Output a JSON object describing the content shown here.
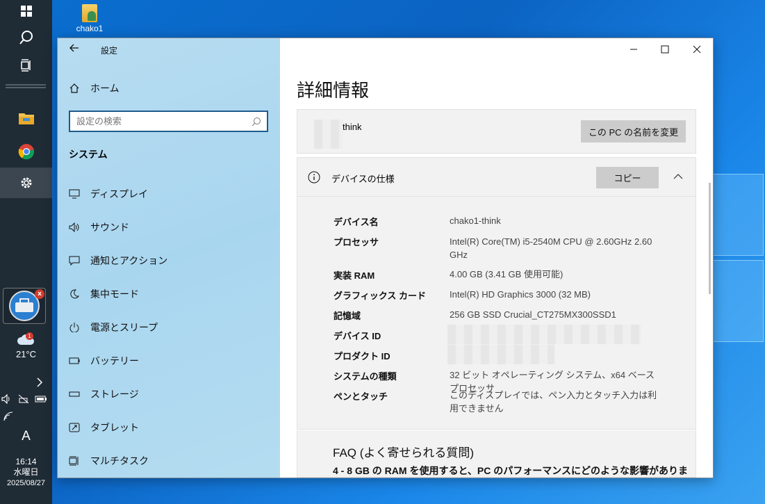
{
  "desktop": {
    "icon_label": "chako1"
  },
  "taskbar": {
    "weather_badge": "1",
    "temperature": "21°C",
    "ime": "A",
    "time": "16:14",
    "weekday": "水曜日",
    "date": "2025/08/27",
    "app_badge": "x"
  },
  "window": {
    "app_title": "設定",
    "search_placeholder": "設定の検索",
    "section_heading": "システム",
    "home_label": "ホーム",
    "nav_items": [
      {
        "label": "ディスプレイ",
        "icon": "display-icon"
      },
      {
        "label": "サウンド",
        "icon": "speaker-icon"
      },
      {
        "label": "通知とアクション",
        "icon": "notification-icon"
      },
      {
        "label": "集中モード",
        "icon": "moon-icon"
      },
      {
        "label": "電源とスリープ",
        "icon": "power-icon"
      },
      {
        "label": "バッテリー",
        "icon": "battery-icon"
      },
      {
        "label": "ストレージ",
        "icon": "storage-icon"
      },
      {
        "label": "タブレット",
        "icon": "tablet-icon"
      },
      {
        "label": "マルチタスク",
        "icon": "multitask-icon"
      }
    ]
  },
  "main": {
    "page_title": "詳細情報",
    "pc_name_suffix": "think",
    "rename_button": "この PC の名前を変更",
    "device_spec_heading": "デバイスの仕様",
    "copy_button": "コピー",
    "specs": [
      {
        "label": "デバイス名",
        "value": "chako1-think"
      },
      {
        "label": "プロセッサ",
        "value": "Intel(R)   Core(TM)   i5-2540M   CPU   @   2.60GHz 2.60 GHz"
      },
      {
        "label": "実装 RAM",
        "value": "4.00 GB (3.41 GB 使用可能)"
      },
      {
        "label": "グラフィックス カード",
        "value": "Intel(R) HD Graphics 3000 (32 MB)"
      },
      {
        "label": "記憶域",
        "value": "256 GB SSD Crucial_CT275MX300SSD1"
      },
      {
        "label": "デバイス ID",
        "value": ""
      },
      {
        "label": "プロダクト ID",
        "value": ""
      },
      {
        "label": "システムの種類",
        "value": "32 ビット オペレーティング システム、x64 ベース プロセッサ"
      },
      {
        "label": "ペンとタッチ",
        "value": "このディスプレイでは、ペン入力とタッチ入力は利用できません"
      }
    ],
    "faq_title": "FAQ (よく寄せられる質問)",
    "faq_question": "4 - 8 GB の RAM を使用すると、PC のパフォーマンスにどのような影響がありま"
  }
}
